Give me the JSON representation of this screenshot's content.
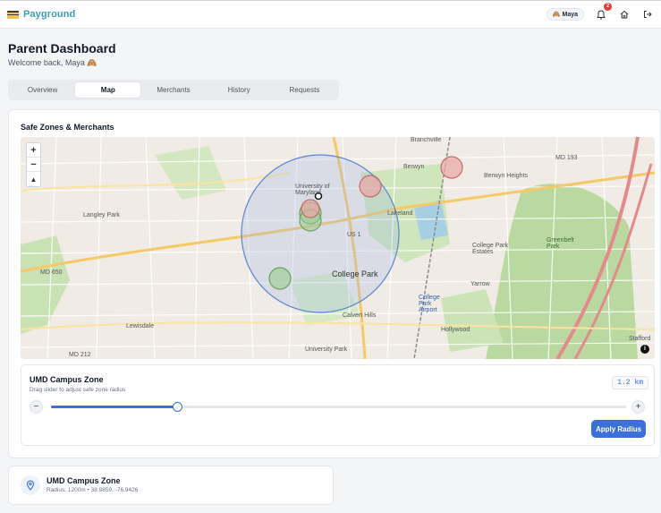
{
  "app": {
    "name": "Payground"
  },
  "header": {
    "user_name": "Maya",
    "notification_count": "2"
  },
  "page": {
    "title": "Parent Dashboard",
    "welcome": "Welcome back, Maya 🙈"
  },
  "tabs": [
    {
      "label": "Overview",
      "active": false
    },
    {
      "label": "Map",
      "active": true
    },
    {
      "label": "Merchants",
      "active": false
    },
    {
      "label": "History",
      "active": false
    },
    {
      "label": "Requests",
      "active": false
    }
  ],
  "map_card": {
    "title": "Safe Zones & Merchants",
    "zoom_in": "+",
    "zoom_out": "−",
    "map_labels": [
      "Branchville",
      "Berwyn",
      "Berwyn Heights",
      "University of Maryland",
      "Lakeland",
      "Langley Park",
      "College Park",
      "College Park Estates",
      "Greenbelt Park",
      "Calvert Hills",
      "Lewisdale",
      "University Park",
      "Yarrow",
      "Hollywood",
      "Stafford",
      "MD 193",
      "MD 650",
      "MD 212",
      "US 1",
      "College Park Airport"
    ]
  },
  "zone_panel": {
    "name": "UMD Campus Zone",
    "hint": "Drag slider to adjust safe zone radius",
    "radius_display": "1.2 km",
    "slider_fraction": 0.22,
    "minus_label": "−",
    "plus_label": "+",
    "apply_label": "Apply Radius"
  },
  "zone_list": [
    {
      "name": "UMD Campus Zone",
      "detail": "Radius: 1200m • 38.9859, -76.9426"
    }
  ],
  "colors": {
    "accent": "#3b6fd9",
    "brand": "#3aa0b8",
    "badge": "#e53935"
  }
}
